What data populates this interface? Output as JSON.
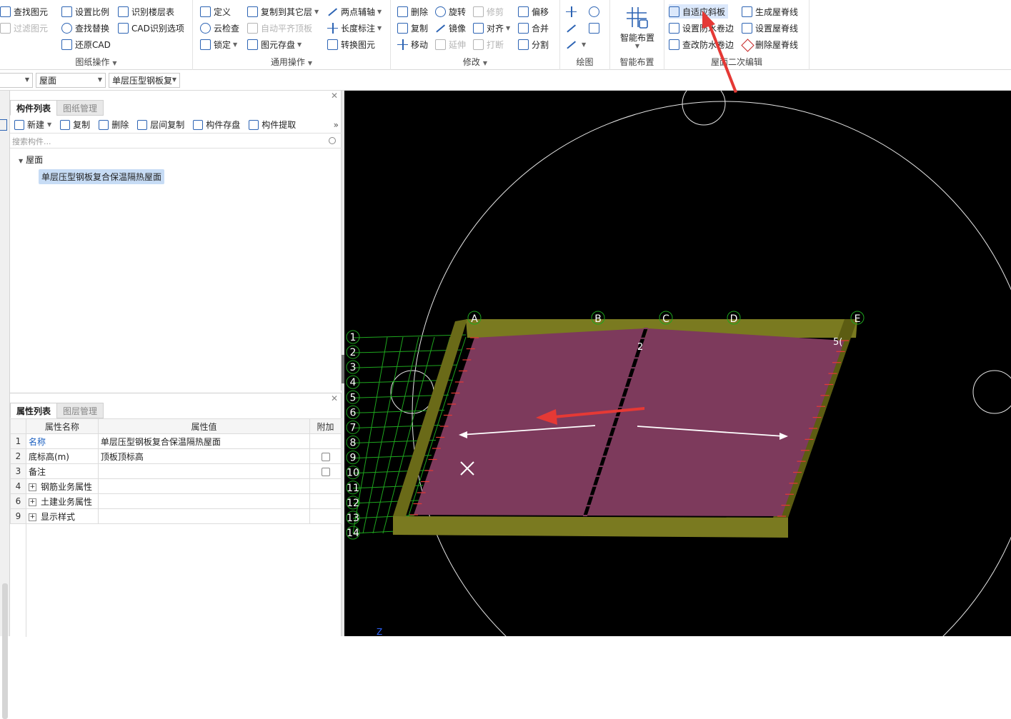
{
  "ribbon": {
    "group_drawing": {
      "find_element": "查找图元",
      "filter_element": "过滤图元",
      "set_scale": "设置比例",
      "find_replace": "查找替换",
      "restore_cad": "还原CAD",
      "identify_floor_table": "识别楼层表",
      "cad_options": "CAD识别选项",
      "title": "图纸操作"
    },
    "group_common": {
      "define": "定义",
      "cloud_check": "云检查",
      "lock": "锁定",
      "copy_to_other": "复制到其它层",
      "auto_align_slab": "自动平齐顶板",
      "element_save": "图元存盘",
      "two_point_aux": "两点辅轴",
      "length_dim": "长度标注",
      "convert_element": "转换图元",
      "title": "通用操作"
    },
    "group_modify": {
      "delete": "删除",
      "copy": "复制",
      "move": "移动",
      "rotate": "旋转",
      "mirror": "镜像",
      "extend": "延伸",
      "trim": "修剪",
      "align": "对齐",
      "break": "打断",
      "offset": "偏移",
      "merge": "合并",
      "split": "分割",
      "title": "修改"
    },
    "group_draw": {
      "title": "绘图"
    },
    "group_smart": {
      "smart_layout": "智能布置",
      "title": "智能布置"
    },
    "group_roof": {
      "adaptive_slope": "自适应斜板",
      "set_waterproof_edge": "设置防水卷边",
      "check_waterproof_edge": "查改防水卷边",
      "gen_ridge": "生成屋脊线",
      "set_ridge": "设置屋脊线",
      "del_ridge": "删除屋脊线",
      "title": "屋面二次编辑"
    }
  },
  "selectors": {
    "floor": "",
    "category": "屋面",
    "component": "单层压型钢板复"
  },
  "component_panel": {
    "tabs": [
      "构件列表",
      "图纸管理"
    ],
    "tools": [
      "新建",
      "复制",
      "删除",
      "层间复制",
      "构件存盘",
      "构件提取"
    ],
    "more": "»",
    "search_placeholder": "搜索构件...",
    "tree_root": "屋面",
    "tree_leaf": "单层压型钢板复合保温隔热屋面"
  },
  "property_panel": {
    "tabs": [
      "属性列表",
      "图层管理"
    ],
    "headers": [
      "属性名称",
      "属性值",
      "附加"
    ],
    "rows": [
      {
        "num": "1",
        "name": "名称",
        "value": "单层压型钢板复合保温隔热屋面"
      },
      {
        "num": "2",
        "name": "底标高(m)",
        "value": "顶板顶标高"
      },
      {
        "num": "3",
        "name": "备注",
        "value": ""
      },
      {
        "num": "4",
        "name": "钢筋业务属性",
        "value": ""
      },
      {
        "num": "6",
        "name": "土建业务属性",
        "value": ""
      },
      {
        "num": "9",
        "name": "显示样式",
        "value": ""
      }
    ]
  },
  "viewport": {
    "axis_letters": [
      "A",
      "B",
      "C",
      "D",
      "E"
    ],
    "axis_numbers": [
      "1",
      "2",
      "3",
      "4",
      "5",
      "6",
      "7",
      "8",
      "9",
      "10",
      "11",
      "12",
      "13",
      "14"
    ],
    "fragment_a": "2",
    "fragment_b": "5(",
    "z_label": "Z",
    "colors": {
      "roof": "#7d3a5c",
      "wall": "#7a7a20",
      "grid": "#1ea51e",
      "white": "#ffffff",
      "arrow": "#e53935"
    }
  }
}
